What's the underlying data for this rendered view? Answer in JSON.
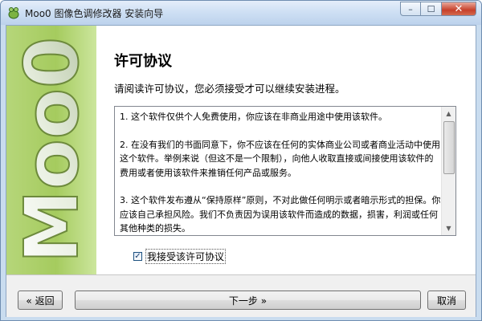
{
  "window": {
    "title": "Moo0 图像色调修改器 安装向导",
    "controls": {
      "minimize": "–",
      "maximize": "☐",
      "close": "✕"
    }
  },
  "sidebar": {
    "logo_text": "Moo0"
  },
  "page": {
    "title": "许可协议",
    "subtitle": "请阅读许可协议，您必须接受才可以继续安装进程。"
  },
  "license": {
    "paragraphs": [
      "1. 这个软件仅供个人免费使用，你应该在非商业用途中使用该软件。",
      "2. 在没有我们的书面同意下，你不应该在任何的实体商业公司或者商业活动中使用这个软件。举例来说（但这不是一个限制），向他人收取直接或间接使用该软件的费用或者使用该软件来推销任何产品或服务。",
      "3. 这个软件发布遵从“保持原样”原则，不对此做任何明示或者暗示形式的担保。你应该自己承担风险。我们不负责因为误用该软件而造成的数据，损害，利润或任何其他种类的损失。"
    ]
  },
  "agree": {
    "label": "我接受该许可协议",
    "checked": true,
    "check_glyph": "✓"
  },
  "buttons": {
    "back": "« 返回",
    "next": "下一步 »",
    "cancel": "取消"
  },
  "colors": {
    "sidebar_green": "#a5cb5e",
    "title_bar": "#cfe0f4"
  },
  "icons": [
    "app-icon",
    "minimize-icon",
    "maximize-icon",
    "close-icon",
    "scroll-up-icon",
    "scroll-down-icon"
  ]
}
